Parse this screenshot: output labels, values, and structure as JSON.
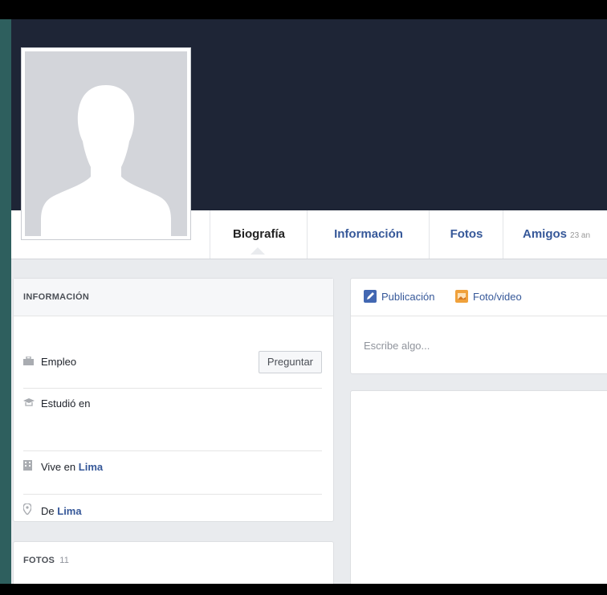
{
  "profile": {
    "tabs": [
      {
        "label": "Biografía"
      },
      {
        "label": "Información"
      },
      {
        "label": "Fotos"
      },
      {
        "label": "Amigos",
        "count": "23 an"
      }
    ]
  },
  "info": {
    "header": "INFORMACIÓN",
    "ask_label": "Preguntar",
    "rows": [
      {
        "icon": "briefcase-icon",
        "label": "Empleo"
      },
      {
        "icon": "graduation-cap-icon",
        "label": "Estudió en"
      },
      {
        "icon": "building-icon",
        "label": "Vive en",
        "place": "Lima"
      },
      {
        "icon": "location-pin-icon",
        "label": "De",
        "place": "Lima"
      }
    ]
  },
  "photos": {
    "header": "FOTOS",
    "count": "11"
  },
  "composer": {
    "tabs": [
      {
        "label": "Publicación",
        "icon": "pencil-icon"
      },
      {
        "label": "Foto/video",
        "icon": "photo-icon"
      }
    ],
    "placeholder": "Escribe algo..."
  },
  "colors": {
    "cover": "#1e2536",
    "link": "#365899",
    "page_bg": "#e9ebee"
  }
}
